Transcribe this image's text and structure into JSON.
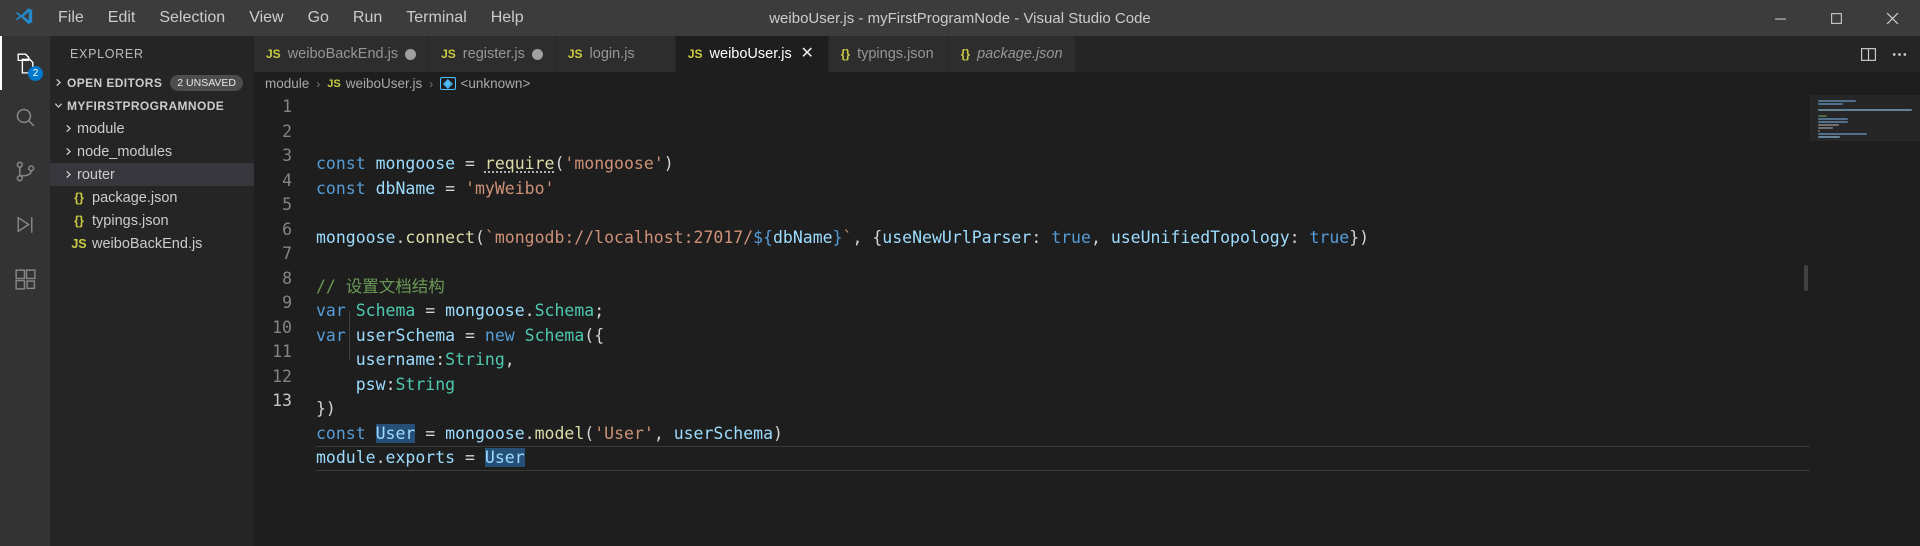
{
  "window": {
    "title": "weiboUser.js - myFirstProgramNode - Visual Studio Code",
    "logo_icon": "vscode-logo-icon",
    "minimize_icon": "minimize-icon",
    "maximize_icon": "maximize-icon",
    "close_icon": "close-icon"
  },
  "menubar": {
    "items": [
      {
        "label": "File"
      },
      {
        "label": "Edit"
      },
      {
        "label": "Selection"
      },
      {
        "label": "View"
      },
      {
        "label": "Go"
      },
      {
        "label": "Run"
      },
      {
        "label": "Terminal"
      },
      {
        "label": "Help"
      }
    ]
  },
  "activitybar": {
    "items": [
      {
        "name": "explorer",
        "icon": "files-icon",
        "active": true,
        "badge": "2"
      },
      {
        "name": "search",
        "icon": "search-icon",
        "active": false,
        "badge": ""
      },
      {
        "name": "source-control",
        "icon": "source-control-icon",
        "active": false,
        "badge": ""
      },
      {
        "name": "run-and-debug",
        "icon": "debug-icon",
        "active": false,
        "badge": ""
      },
      {
        "name": "extensions",
        "icon": "extensions-icon",
        "active": false,
        "badge": ""
      }
    ]
  },
  "sidebar": {
    "title": "EXPLORER",
    "open_editors": {
      "label": "OPEN EDITORS",
      "badge": "2 UNSAVED",
      "expanded": false
    },
    "project": {
      "label": "MYFIRSTPROGRAMNODE",
      "expanded": true
    },
    "tree": [
      {
        "label": "module",
        "type": "folder",
        "icon": "chevron-right-icon",
        "selected": false
      },
      {
        "label": "node_modules",
        "type": "folder",
        "icon": "chevron-right-icon",
        "selected": false
      },
      {
        "label": "router",
        "type": "folder",
        "icon": "chevron-right-icon",
        "selected": true
      },
      {
        "label": "package.json",
        "type": "json",
        "icon": "json-file-icon",
        "selected": false
      },
      {
        "label": "typings.json",
        "type": "json",
        "icon": "json-file-icon",
        "selected": false
      },
      {
        "label": "weiboBackEnd.js",
        "type": "js",
        "icon": "js-file-icon",
        "selected": false
      }
    ]
  },
  "tabbar": {
    "tabs": [
      {
        "label": "weiboBackEnd.js",
        "kind": "js",
        "icon_text": "JS",
        "dirty": true,
        "active": false,
        "italic": false
      },
      {
        "label": "register.js",
        "kind": "js",
        "icon_text": "JS",
        "dirty": true,
        "active": false,
        "italic": false
      },
      {
        "label": "login.js",
        "kind": "js",
        "icon_text": "JS",
        "dirty": false,
        "active": false,
        "italic": false
      },
      {
        "label": "weiboUser.js",
        "kind": "js",
        "icon_text": "JS",
        "dirty": false,
        "active": true,
        "italic": false
      },
      {
        "label": "typings.json",
        "kind": "json",
        "icon_text": "{}",
        "dirty": false,
        "active": false,
        "italic": false
      },
      {
        "label": "package.json",
        "kind": "json",
        "icon_text": "{}",
        "dirty": false,
        "active": false,
        "italic": true
      }
    ],
    "actions": [
      {
        "name": "split-editor-icon"
      },
      {
        "name": "more-actions-icon"
      }
    ]
  },
  "breadcrumbs": {
    "items": [
      {
        "label": "module",
        "icon": ""
      },
      {
        "label": "weiboUser.js",
        "icon": "js-file-icon"
      },
      {
        "label": "<unknown>",
        "icon": "symbol-icon"
      }
    ],
    "separator": "›"
  },
  "editor": {
    "language": "javascript",
    "line_numbers": [
      "1",
      "2",
      "3",
      "4",
      "5",
      "6",
      "7",
      "8",
      "9",
      "10",
      "11",
      "12",
      "13"
    ],
    "current_line": 13,
    "selection_text": "User",
    "lines": [
      {
        "n": 1,
        "tokens": [
          {
            "t": "const",
            "c": "t-key"
          },
          {
            "t": " ",
            "c": "t-plain"
          },
          {
            "t": "mongoose",
            "c": "t-var"
          },
          {
            "t": " = ",
            "c": "t-plain"
          },
          {
            "t": "require",
            "c": "t-fn squiggle"
          },
          {
            "t": "(",
            "c": "t-plain"
          },
          {
            "t": "'mongoose'",
            "c": "t-str"
          },
          {
            "t": ")",
            "c": "t-plain"
          }
        ]
      },
      {
        "n": 2,
        "tokens": [
          {
            "t": "const",
            "c": "t-key"
          },
          {
            "t": " ",
            "c": "t-plain"
          },
          {
            "t": "dbName",
            "c": "t-var"
          },
          {
            "t": " = ",
            "c": "t-plain"
          },
          {
            "t": "'myWeibo'",
            "c": "t-str"
          }
        ]
      },
      {
        "n": 3,
        "tokens": []
      },
      {
        "n": 4,
        "tokens": [
          {
            "t": "mongoose",
            "c": "t-var"
          },
          {
            "t": ".",
            "c": "t-plain"
          },
          {
            "t": "connect",
            "c": "t-fn"
          },
          {
            "t": "(",
            "c": "t-plain"
          },
          {
            "t": "`mongodb://localhost:27017/",
            "c": "t-str"
          },
          {
            "t": "${",
            "c": "t-tmpl"
          },
          {
            "t": "dbName",
            "c": "t-var"
          },
          {
            "t": "}",
            "c": "t-tmpl"
          },
          {
            "t": "`",
            "c": "t-str"
          },
          {
            "t": ", {",
            "c": "t-plain"
          },
          {
            "t": "useNewUrlParser",
            "c": "t-var"
          },
          {
            "t": ": ",
            "c": "t-plain"
          },
          {
            "t": "true",
            "c": "t-key"
          },
          {
            "t": ", ",
            "c": "t-plain"
          },
          {
            "t": "useUnifiedTopology",
            "c": "t-var"
          },
          {
            "t": ": ",
            "c": "t-plain"
          },
          {
            "t": "true",
            "c": "t-key"
          },
          {
            "t": "})",
            "c": "t-plain"
          }
        ]
      },
      {
        "n": 5,
        "tokens": []
      },
      {
        "n": 6,
        "tokens": [
          {
            "t": "// 设置文档结构",
            "c": "t-cmt"
          }
        ]
      },
      {
        "n": 7,
        "tokens": [
          {
            "t": "var",
            "c": "t-key"
          },
          {
            "t": " ",
            "c": "t-plain"
          },
          {
            "t": "Schema",
            "c": "t-cls"
          },
          {
            "t": " = ",
            "c": "t-plain"
          },
          {
            "t": "mongoose",
            "c": "t-var"
          },
          {
            "t": ".",
            "c": "t-plain"
          },
          {
            "t": "Schema",
            "c": "t-cls"
          },
          {
            "t": ";",
            "c": "t-plain"
          }
        ]
      },
      {
        "n": 8,
        "tokens": [
          {
            "t": "var",
            "c": "t-key"
          },
          {
            "t": " ",
            "c": "t-plain"
          },
          {
            "t": "userSchema",
            "c": "t-var"
          },
          {
            "t": " = ",
            "c": "t-plain"
          },
          {
            "t": "new",
            "c": "t-key"
          },
          {
            "t": " ",
            "c": "t-plain"
          },
          {
            "t": "Schema",
            "c": "t-cls"
          },
          {
            "t": "({",
            "c": "t-plain"
          }
        ]
      },
      {
        "n": 9,
        "tokens": [
          {
            "t": "    ",
            "c": "t-plain"
          },
          {
            "t": "username",
            "c": "t-var"
          },
          {
            "t": ":",
            "c": "t-plain"
          },
          {
            "t": "String",
            "c": "t-cls"
          },
          {
            "t": ",",
            "c": "t-plain"
          }
        ]
      },
      {
        "n": 10,
        "tokens": [
          {
            "t": "    ",
            "c": "t-plain"
          },
          {
            "t": "psw",
            "c": "t-var"
          },
          {
            "t": ":",
            "c": "t-plain"
          },
          {
            "t": "String",
            "c": "t-cls"
          }
        ]
      },
      {
        "n": 11,
        "tokens": [
          {
            "t": "})",
            "c": "t-plain"
          }
        ]
      },
      {
        "n": 12,
        "tokens": [
          {
            "t": "const",
            "c": "t-key"
          },
          {
            "t": " ",
            "c": "t-plain"
          },
          {
            "t": "User",
            "c": "t-var sel"
          },
          {
            "t": " = ",
            "c": "t-plain"
          },
          {
            "t": "mongoose",
            "c": "t-var"
          },
          {
            "t": ".",
            "c": "t-plain"
          },
          {
            "t": "model",
            "c": "t-fn"
          },
          {
            "t": "(",
            "c": "t-plain"
          },
          {
            "t": "'User'",
            "c": "t-str"
          },
          {
            "t": ", ",
            "c": "t-plain"
          },
          {
            "t": "userSchema",
            "c": "t-var"
          },
          {
            "t": ")",
            "c": "t-plain"
          }
        ]
      },
      {
        "n": 13,
        "tokens": [
          {
            "t": "module",
            "c": "t-var"
          },
          {
            "t": ".",
            "c": "t-plain"
          },
          {
            "t": "exports",
            "c": "t-var"
          },
          {
            "t": " = ",
            "c": "t-plain"
          },
          {
            "t": "User",
            "c": "t-var sel"
          }
        ]
      }
    ]
  },
  "colors": {
    "titlebar_bg": "#3c3c3c",
    "activitybar_bg": "#333333",
    "sidebar_bg": "#252526",
    "editor_bg": "#1e1e1e",
    "accent": "#007acc",
    "selection": "#264f78"
  }
}
